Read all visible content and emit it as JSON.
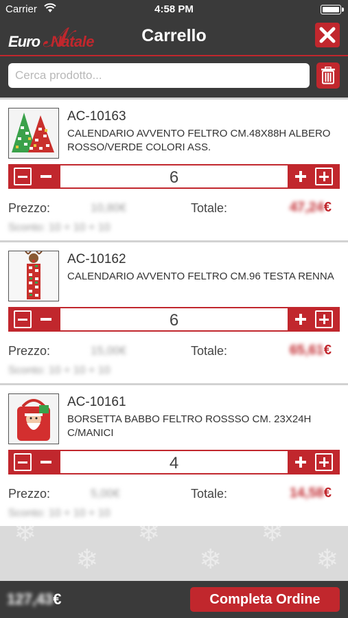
{
  "status_bar": {
    "carrier": "Carrier",
    "time": "4:58 PM"
  },
  "header": {
    "logo_part1": "Euro",
    "logo_part2": "Natale",
    "title": "Carrello"
  },
  "search": {
    "placeholder": "Cerca prodotto..."
  },
  "labels": {
    "price": "Prezzo:",
    "total": "Totale:",
    "currency": "€"
  },
  "items": [
    {
      "code": "AC-10163",
      "description": "CALENDARIO AVVENTO FELTRO CM.48X88H ALBERO ROSSO/VERDE COLORI ASS.",
      "quantity": "6",
      "price": "10,80€",
      "total": "47,24",
      "discount": "Sconto: 10 + 10 + 10",
      "image": "christmas-tree-calendar"
    },
    {
      "code": "AC-10162",
      "description": "CALENDARIO AVVENTO FELTRO CM.96 TESTA RENNA",
      "quantity": "6",
      "price": "15,00€",
      "total": "65,61",
      "discount": "Sconto: 10 + 10 + 10",
      "image": "reindeer-calendar"
    },
    {
      "code": "AC-10161",
      "description": "BORSETTA BABBO FELTRO ROSSSO CM. 23X24H C/MANICI",
      "quantity": "4",
      "price": "5,00€",
      "total": "14,58",
      "discount": "Sconto: 10 + 10 + 10",
      "image": "santa-bag"
    }
  ],
  "footer": {
    "grand_total": "127,43",
    "complete_label": "Completa Ordine"
  },
  "colors": {
    "accent": "#c1272d",
    "bar": "#3a3a3a",
    "background": "#d9d9d9"
  }
}
